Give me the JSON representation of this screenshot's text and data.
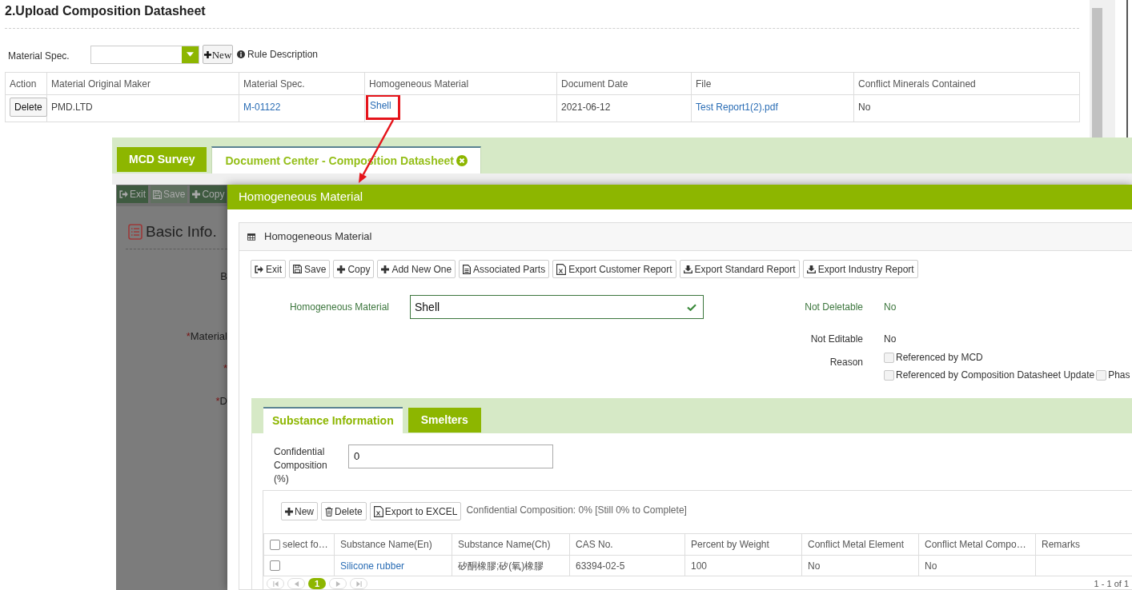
{
  "upload_section": {
    "title": "2.Upload Composition Datasheet",
    "filter": {
      "label": "Material Spec.",
      "new_button": "New",
      "rule_link": "Rule Description"
    },
    "table": {
      "columns": [
        "Action",
        "Material Original Maker",
        "Material Spec.",
        "Homogeneous Material",
        "Document Date",
        "File",
        "Conflict Minerals Contained"
      ],
      "rows": [
        {
          "cells": [
            {
              "kind": "button",
              "text": "Delete",
              "highlighted": false
            },
            {
              "kind": "text",
              "text": "PMD.LTD",
              "highlighted": false
            },
            {
              "kind": "link",
              "text": "M-01122",
              "highlighted": false
            },
            {
              "kind": "link",
              "text": "Shell",
              "highlighted": true
            },
            {
              "kind": "text",
              "text": "2021-06-12",
              "highlighted": false
            },
            {
              "kind": "link",
              "text": "Test Report1(2).pdf",
              "highlighted": false
            },
            {
              "kind": "text",
              "text": "No",
              "highlighted": false
            }
          ]
        }
      ]
    }
  },
  "app_tabs": [
    {
      "label": "MCD Survey",
      "selected": false,
      "closable": false
    },
    {
      "label": "Document Center - Composition Datasheet",
      "selected": true,
      "closable": true
    }
  ],
  "background_page": {
    "toolbar": [
      {
        "label": "Exit",
        "kind": "exit",
        "disabled": false
      },
      {
        "label": "Save",
        "kind": "save",
        "disabled": true
      },
      {
        "label": "Copy",
        "kind": "add",
        "disabled": false
      }
    ],
    "section_title": "Basic Info.",
    "labels": [
      {
        "text": "B"
      },
      {
        "required_mark": "*",
        "text": "Material"
      },
      {
        "required_mark": "*"
      },
      {
        "required_mark": "*",
        "text": "D"
      }
    ]
  },
  "dialog": {
    "title": "Homogeneous Material",
    "panel_title": "Homogeneous Material",
    "toolbar": [
      {
        "label": "Exit",
        "kind": "exit"
      },
      {
        "label": "Save",
        "kind": "save"
      },
      {
        "label": "Copy",
        "kind": "add"
      },
      {
        "label": "Add New One",
        "kind": "add"
      },
      {
        "label": "Associated Parts",
        "kind": "document"
      },
      {
        "label": "Export Customer Report",
        "kind": "excel"
      },
      {
        "label": "Export Standard Report",
        "kind": "download"
      },
      {
        "label": "Export Industry Report",
        "kind": "download"
      }
    ],
    "material_field": {
      "label": "Homogeneous Material",
      "value": "Shell",
      "valid": true
    },
    "properties": [
      {
        "label": "Not Deletable",
        "value": "No",
        "valid": true
      },
      {
        "label": "Not Editable",
        "value": "No",
        "valid": false
      }
    ],
    "reason": {
      "label": "Reason",
      "options": [
        {
          "label": "Referenced by MCD",
          "checked": false,
          "disabled": true
        },
        {
          "label": "Referenced by Composition Datasheet Update",
          "checked": false,
          "disabled": true
        },
        {
          "label": "Phas",
          "checked": false,
          "disabled": true
        }
      ]
    },
    "tabs": [
      {
        "label": "Substance Information",
        "selected": true
      },
      {
        "label": "Smelters",
        "selected": false
      }
    ],
    "confidential_field": {
      "label": "Confidential Composition (%)",
      "value": "0"
    },
    "grid_toolbar": [
      {
        "label": "New",
        "kind": "add"
      },
      {
        "label": "Delete",
        "kind": "trash"
      },
      {
        "label": "Export to EXCEL",
        "kind": "excel"
      }
    ],
    "summary": "Confidential Composition: 0% [Still 0% to Complete]",
    "table": {
      "select_column": {
        "label": "select fo…",
        "checked": false
      },
      "columns": [
        "Substance Name(En)",
        "Substance Name(Ch)",
        "CAS No.",
        "Percent by Weight",
        "Conflict Metal Element",
        "Conflict Metal Compo…",
        "Remarks"
      ],
      "rows": [
        {
          "selected": false,
          "cells": [
            {
              "kind": "link",
              "text": "Silicone rubber"
            },
            {
              "kind": "text",
              "text": "矽酮橡膠;矽(氧)橡膠"
            },
            {
              "kind": "text",
              "text": "63394-02-5"
            },
            {
              "kind": "text",
              "text": "100"
            },
            {
              "kind": "text",
              "text": "No"
            },
            {
              "kind": "text",
              "text": "No"
            }
          ]
        }
      ]
    },
    "pager": {
      "pages": [
        {
          "label": "1",
          "selected": true
        }
      ],
      "summary": "1 - 1 of 1"
    }
  }
}
